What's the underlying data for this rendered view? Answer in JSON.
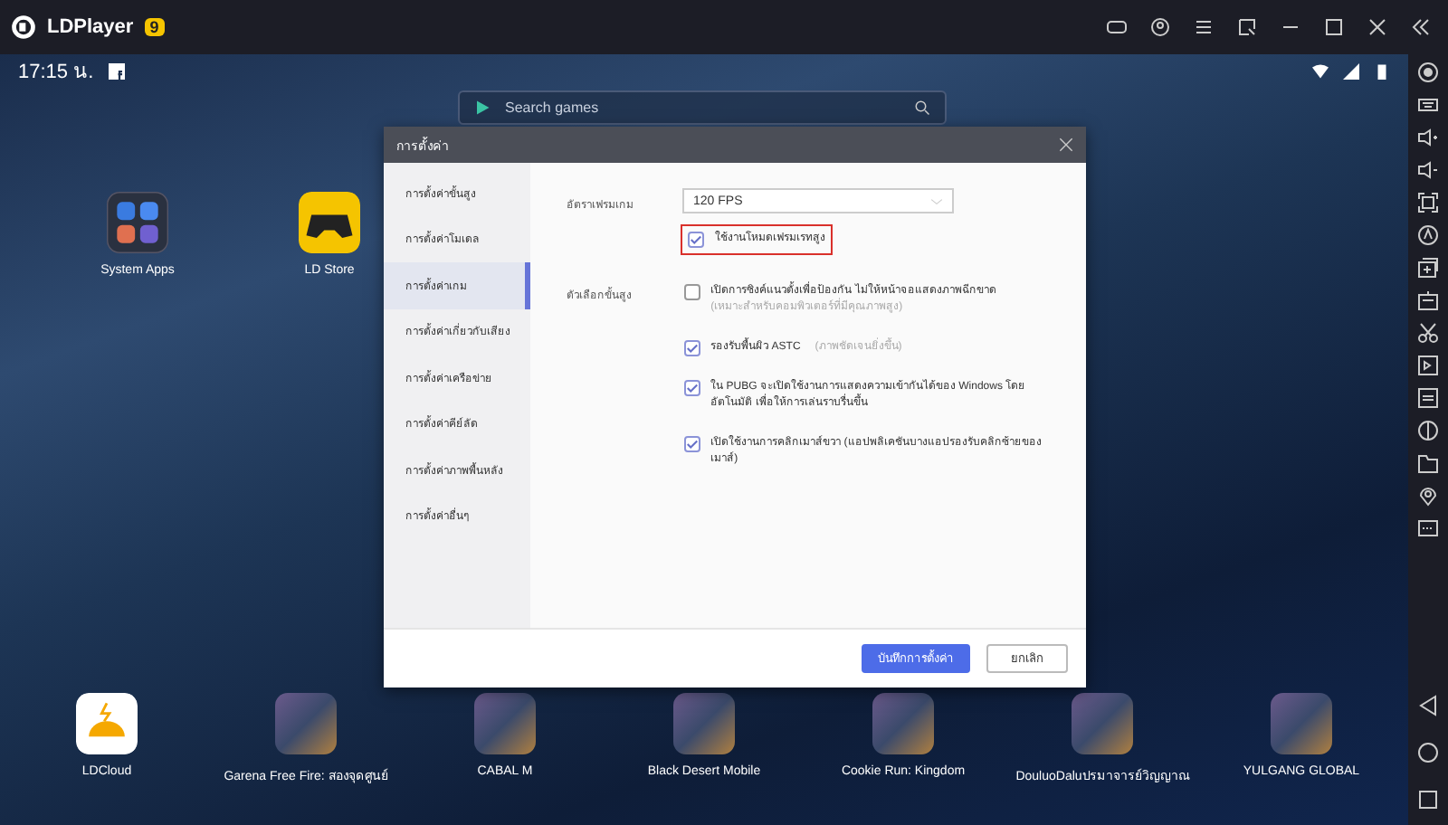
{
  "app": {
    "title": "LDPlayer",
    "badge": "9"
  },
  "status_bar": {
    "time": "17:15 น."
  },
  "search": {
    "placeholder": "Search games"
  },
  "desktop_apps": [
    {
      "label": "System Apps",
      "kind": "folder"
    },
    {
      "label": "LD Store",
      "kind": "store"
    }
  ],
  "dialog": {
    "title": "การตั้งค่า",
    "sidebar": [
      {
        "label": "การตั้งค่าขั้นสูง",
        "selected": false
      },
      {
        "label": "การตั้งค่าโมเดล",
        "selected": false
      },
      {
        "label": "การตั้งค่าเกม",
        "selected": true
      },
      {
        "label": "การตั้งค่าเกี่ยวกับเสียง",
        "selected": false
      },
      {
        "label": "การตั้งค่าเครือข่าย",
        "selected": false
      },
      {
        "label": "การตั้งค่าคีย์ลัด",
        "selected": false
      },
      {
        "label": "การตั้งค่าภาพพื้นหลัง",
        "selected": false
      },
      {
        "label": "การตั้งค่าอื่นๆ",
        "selected": false
      }
    ],
    "frame_rate": {
      "label": "อัตราเฟรมเกม",
      "value": "120 FPS"
    },
    "high_fps": {
      "label": "ใช้งานโหมดเฟรมเรทสูง",
      "checked": true,
      "highlighted": true
    },
    "advanced": {
      "label": "ตัวเลือกขั้นสูง",
      "options": [
        {
          "label": "เปิดการซิงค์แนวตั้งเพื่อป้องกัน ไม่ให้หน้าจอแสดงภาพฉีกขาด",
          "note": "(เหมาะสำหรับคอมพิวเตอร์ที่มีคุณภาพสูง)",
          "checked": false
        },
        {
          "label": "รองรับพื้นผิว ASTC",
          "note": "(ภาพชัดเจนยิ่งขึ้น)",
          "checked": true
        },
        {
          "label": "ใน PUBG จะเปิดใช้งานการแสดงความเข้ากันได้ของ Windows โดยอัตโนมัติ เพื่อให้การเล่นราบรื่นขึ้น",
          "checked": true
        },
        {
          "label": "เปิดใช้งานการคลิกเมาส์ขวา (แอปพลิเคชันบางแอปรองรับคลิกซ้ายของเมาส์)",
          "checked": true
        }
      ]
    },
    "buttons": [
      {
        "label": "บันทึกการตั้งค่า",
        "kind": "primary"
      },
      {
        "label": "ยกเลิก",
        "kind": "secondary"
      }
    ]
  },
  "dock": [
    {
      "label": "LDCloud",
      "kind": "cloud"
    },
    {
      "label": "Garena Free Fire: สองจุดศูนย์",
      "kind": "game"
    },
    {
      "label": "CABAL M",
      "kind": "game"
    },
    {
      "label": "Black Desert Mobile",
      "kind": "game"
    },
    {
      "label": "Cookie Run: Kingdom",
      "kind": "game"
    },
    {
      "label": "DouluoDaluปรมาจารย์วิญญาณ",
      "kind": "game"
    },
    {
      "label": "YULGANG GLOBAL",
      "kind": "game"
    }
  ]
}
